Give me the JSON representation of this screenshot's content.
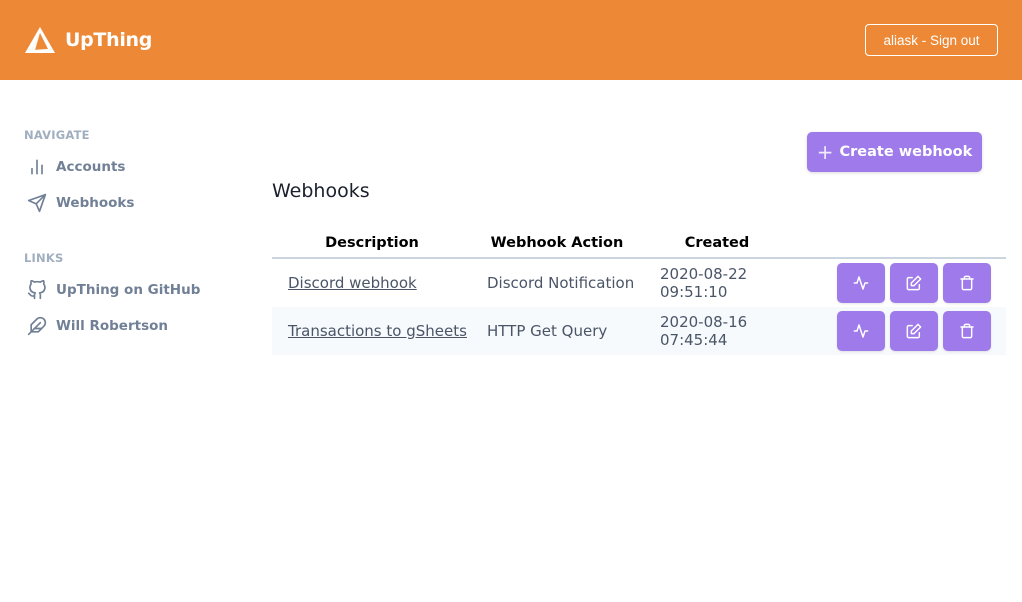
{
  "header": {
    "app_name": "UpThing",
    "signout_label": "aliask - Sign out",
    "background_color": "#ed8936"
  },
  "sidebar": {
    "navigate_label": "NAVIGATE",
    "navigate_items": [
      {
        "label": "Accounts",
        "icon": "bar-chart-icon"
      },
      {
        "label": "Webhooks",
        "icon": "send-icon"
      }
    ],
    "links_label": "LINKS",
    "link_items": [
      {
        "label": "UpThing on GitHub",
        "icon": "github-icon"
      },
      {
        "label": "Will Robertson",
        "icon": "feather-icon"
      }
    ]
  },
  "main": {
    "title": "Webhooks",
    "create_button_label": "Create webhook",
    "accent_color": "#9f7aea",
    "table": {
      "columns": [
        "Description",
        "Webhook Action",
        "Created"
      ],
      "rows": [
        {
          "description": "Discord webhook",
          "action": "Discord Notification",
          "created": "2020-08-22 09:51:10"
        },
        {
          "description": "Transactions to gSheets",
          "action": "HTTP Get Query",
          "created": "2020-08-16 07:45:44"
        }
      ],
      "row_actions": [
        "activity-icon",
        "edit-icon",
        "trash-icon"
      ]
    }
  }
}
